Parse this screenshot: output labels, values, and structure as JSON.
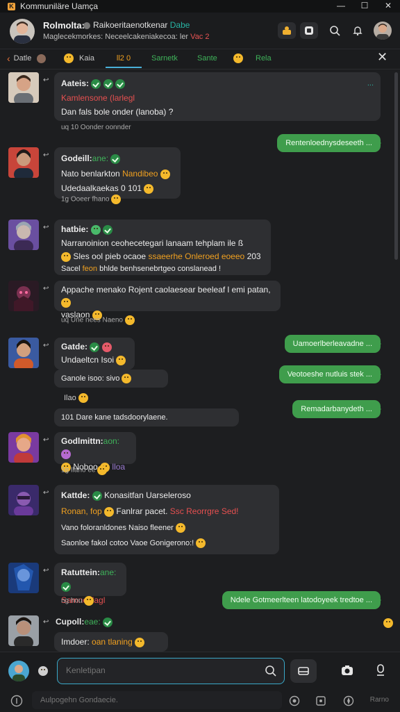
{
  "window": {
    "title": "Kommuniläre Uamça",
    "controls": [
      "—",
      "☐",
      "✕"
    ]
  },
  "header": {
    "name": "Rolmolta:",
    "title_prefix": "Raikoeritaenotkenar",
    "title_highlight": "Dabe",
    "status_prefix": "Maglecekmorkes: Neceelcakeniakecoa: ler",
    "status_suffix": "Vac 2"
  },
  "tabs": {
    "items": [
      {
        "label": "Datle"
      },
      {
        "label": "Kaia"
      },
      {
        "label": "ll2 0"
      },
      {
        "label": "Sarnetk"
      },
      {
        "label": "Sante"
      },
      {
        "label": "Rela"
      }
    ]
  },
  "messages": [
    {
      "name": "Aateis:",
      "line1": "Kamlensone (larlegl",
      "line2": "Dan fals bole  onder (lanoba) ?",
      "meta": "uq  10  Oonder oonnder",
      "tag": "..."
    },
    {
      "name": "Godeill:",
      "name_suffix": "ane:",
      "line1_a": "Nato benlarkton",
      "line1_b": "Nandibeo",
      "line2": "Udedaalkaekas  0  101",
      "meta": "1g  Ooeer  fhano"
    },
    {
      "name": "hatbie:",
      "line1": "Narranoinion ceohecetegari lanaam tehplam  ile  ß",
      "line2_a": "Sles ool pieb ocaoe",
      "line2_b": "ssaeerhe Onleroed eoeeo",
      "line2_c": "203",
      "line3_a": "Sacel",
      "line3_b": "feon",
      "line3_c": "bhlde  benhsenebrtgeo",
      "line3_d": "conslanead !"
    },
    {
      "name": "Appache menako",
      "line1": "Appache menako Rojent caolaesear beeleaf l emi patan,",
      "line2": "vaslaon",
      "meta": "uq  Une nees Naeno"
    },
    {
      "name": "Gatde:",
      "line2": "Undaeltcn  Isoi",
      "sub1": "Ganole isoo:  sivo",
      "sub2": "Ilao",
      "sub3": "101  Dare  kane  tadsdoorylaene."
    },
    {
      "name": "Godlmittn:",
      "name_suffix": "aon:",
      "line2": "Noboo",
      "line2_b": "lloa",
      "meta": "1g  Ilano ee"
    },
    {
      "name": "Kattde:",
      "title": "Konasitfan Uarseleroso",
      "line2_a": "Ronan, fop",
      "line2_b": "Fanlrar pacet.",
      "line2_c": "Ssc Reorrgre Sed!",
      "line3": "Vano foloranldones  Naiso fleener",
      "line4": "Saonloe fakol cotoo  Vaoe Gonigerono:!"
    },
    {
      "name": "Ratuttein:",
      "name_suffix": "ane:",
      "line2": "Samnedlagl",
      "meta": "ng  hou"
    },
    {
      "name": "Cupoll:",
      "name_suffix": "eae:",
      "line2": "Imdoer:",
      "line2_b": "oan  tlaning"
    }
  ],
  "outgoing": [
    {
      "text": "Rentenloednysdeseeth ..."
    },
    {
      "text": "Uamoerlberleavadne ..."
    },
    {
      "text": "Veotoeshe nutluis stek ..."
    },
    {
      "text": "Remadarbanydeth ..."
    },
    {
      "text": "Ndele Gotmeerlteen latodoyeek tredtoe ..."
    }
  ],
  "composer": {
    "placeholder": "Kenletipan",
    "bottom_placeholder": "Aulpogehn Gondaecie.",
    "bottom_label": "Rarno"
  }
}
